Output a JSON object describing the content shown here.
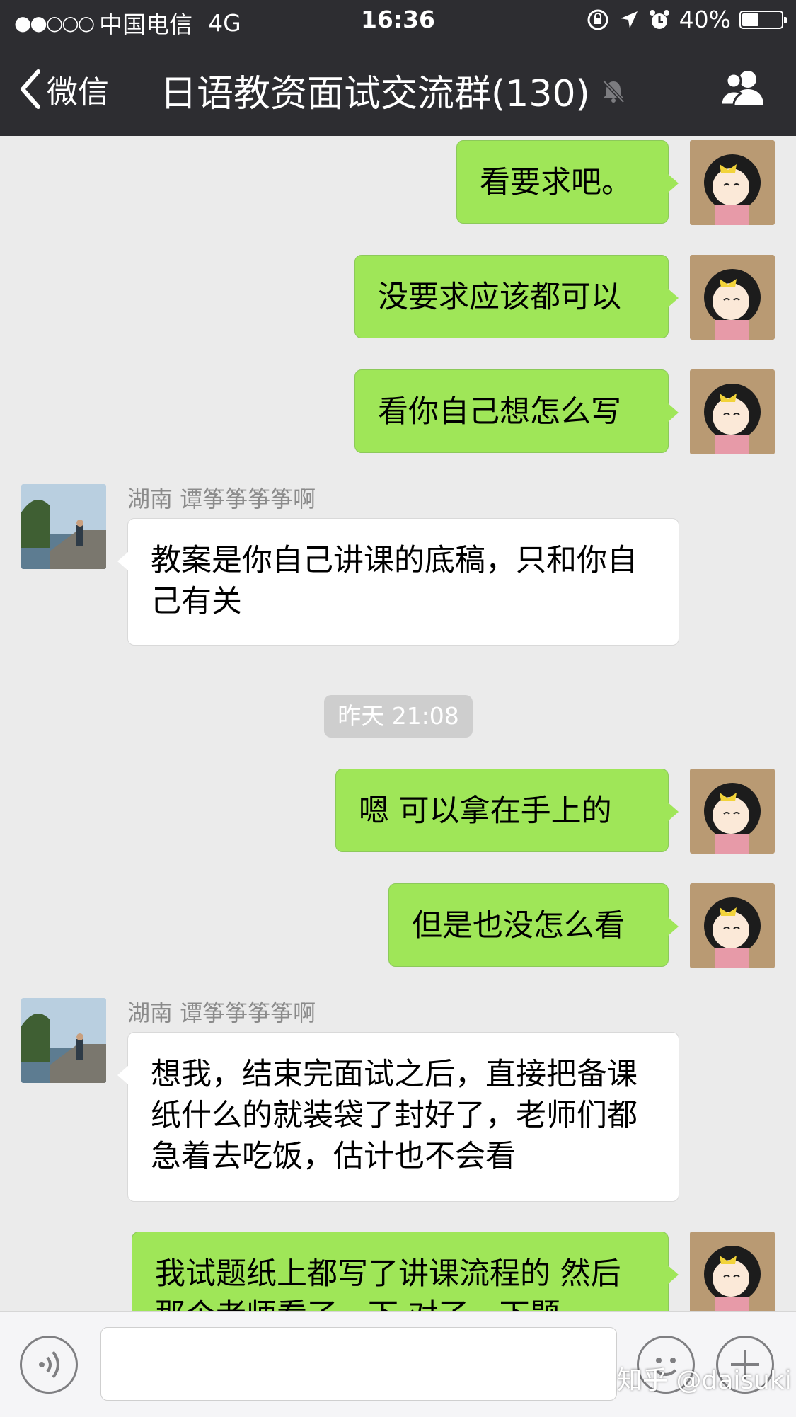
{
  "status_bar": {
    "signal_dots": "●●○○○",
    "carrier": "中国电信",
    "network": "4G",
    "time": "16:36",
    "battery_text": "40%",
    "battery_level": 0.4
  },
  "header": {
    "back_label": "微信",
    "title": "日语教资面试交流群(130)",
    "muted_icon": "bell-muted-icon",
    "members_icon": "people-icon",
    "background": "#2d2d31"
  },
  "chat": {
    "messages": [
      {
        "side": "me",
        "text": "看要求吧。"
      },
      {
        "side": "me",
        "text": "没要求应该都可以"
      },
      {
        "side": "me",
        "text": "看你自己想怎么写"
      },
      {
        "side": "them",
        "sender": "湖南 谭筝筝筝筝啊",
        "text": "教案是你自己讲课的底稿，只和你自己有关"
      },
      {
        "side": "system",
        "text": "昨天 21:08"
      },
      {
        "side": "me",
        "text": "嗯 可以拿在手上的"
      },
      {
        "side": "me",
        "text": "但是也没怎么看"
      },
      {
        "side": "them",
        "sender": "湖南 谭筝筝筝筝啊",
        "text": "想我，结束完面试之后，直接把备课纸什么的就装袋了封好了，老师们都急着去吃饭，估计也不会看"
      },
      {
        "side": "me",
        "text": "我试题纸上都写了讲课流程的 然后那个老师看了一下 对了一下题"
      }
    ],
    "colors": {
      "my_bubble": "#9fe658",
      "their_bubble": "#ffffff",
      "background": "#ebebeb"
    }
  },
  "input_bar": {
    "voice_icon": "voice-icon",
    "input_value": "",
    "emoji_icon": "emoji-icon",
    "plus_icon": "plus-icon",
    "watermark": "知乎 @daisuki"
  }
}
